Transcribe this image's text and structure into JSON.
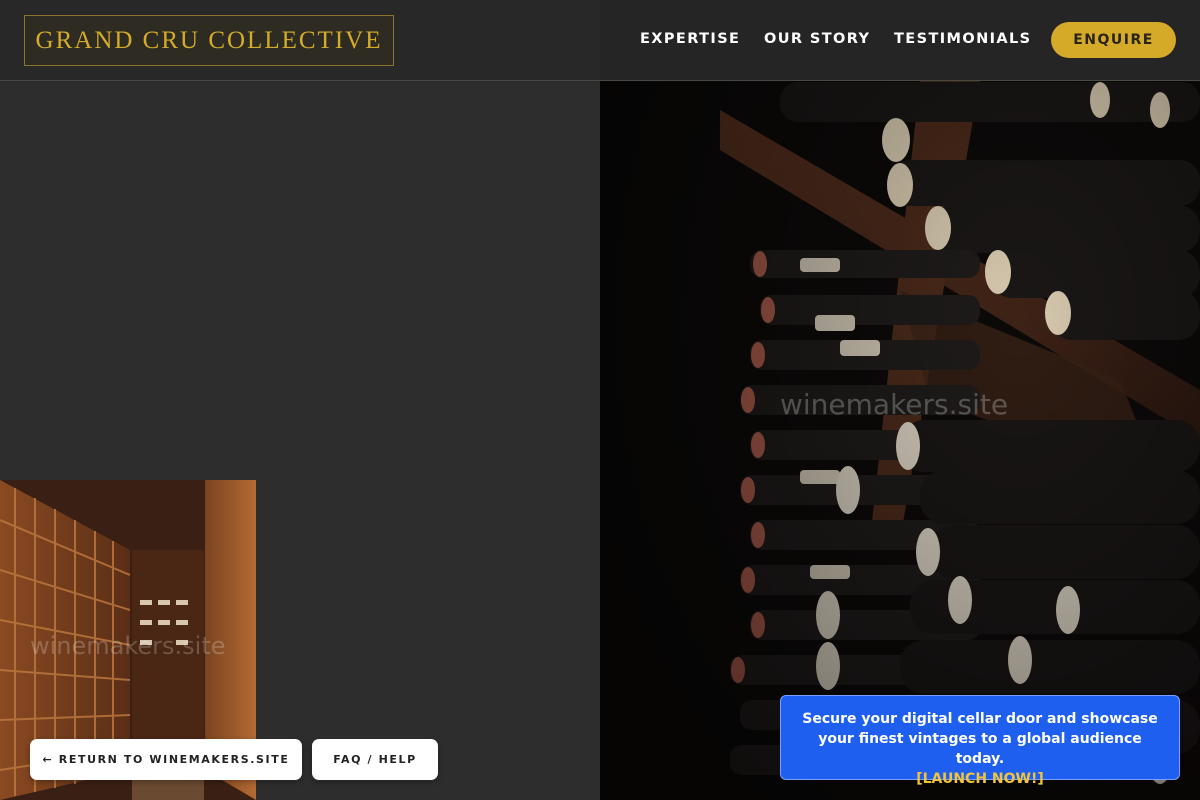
{
  "header": {
    "logo_text": "GRAND CRU COLLECTIVE",
    "nav": [
      "EXPERTISE",
      "OUR STORY",
      "TESTIMONIALS"
    ],
    "cta_label": "ENQUIRE"
  },
  "images": {
    "main_watermark": "winemakers.site",
    "thumb_watermark": "winemakers.site"
  },
  "buttons": {
    "return_label": "← RETURN TO WINEMAKERS.SITE",
    "faq_label": "FAQ / HELP"
  },
  "promo": {
    "text": "Secure your digital cellar door and showcase your finest vintages to a global audience today.",
    "link_label": "[LAUNCH NOW!]"
  },
  "colors": {
    "background": "#2d2d2d",
    "gold_accent": "#d4aa28",
    "promo_blue": "#1f5ff0"
  }
}
